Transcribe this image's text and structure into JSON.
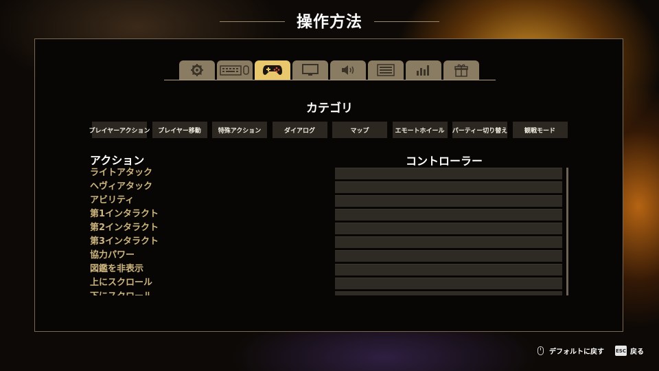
{
  "page": {
    "title": "操作方法"
  },
  "tabs": [
    {
      "icon": "gear-icon",
      "active": false
    },
    {
      "icon": "keyboard-icon",
      "active": false
    },
    {
      "icon": "gamepad-icon",
      "active": true
    },
    {
      "icon": "monitor-icon",
      "active": false
    },
    {
      "icon": "speaker-icon",
      "active": false
    },
    {
      "icon": "list-icon",
      "active": false
    },
    {
      "icon": "stats-icon",
      "active": false
    },
    {
      "icon": "gift-icon",
      "active": false
    }
  ],
  "category": {
    "title": "カテゴリ",
    "items": [
      "プレイヤーアクション",
      "プレイヤー移動",
      "特殊アクション",
      "ダイアログ",
      "マップ",
      "エモートホイール",
      "パーティー切り替え",
      "観戦モード"
    ]
  },
  "columns": {
    "action": "アクション",
    "controller": "コントローラー"
  },
  "actions": [
    "ライトアタック",
    "ヘヴィアタック",
    "アビリティ",
    "第1インタラクト",
    "第2インタラクト",
    "第3インタラクト",
    "協力パワー",
    "図鑑を非表示",
    "上にスクロール",
    "下にスクロール"
  ],
  "footer": {
    "reset": "デフォルトに戻す",
    "esc_key": "ESC",
    "back": "戻る"
  },
  "colors": {
    "accent": "#e9c76c",
    "tab": "#8a7b63",
    "action_text": "#ccb57e"
  }
}
